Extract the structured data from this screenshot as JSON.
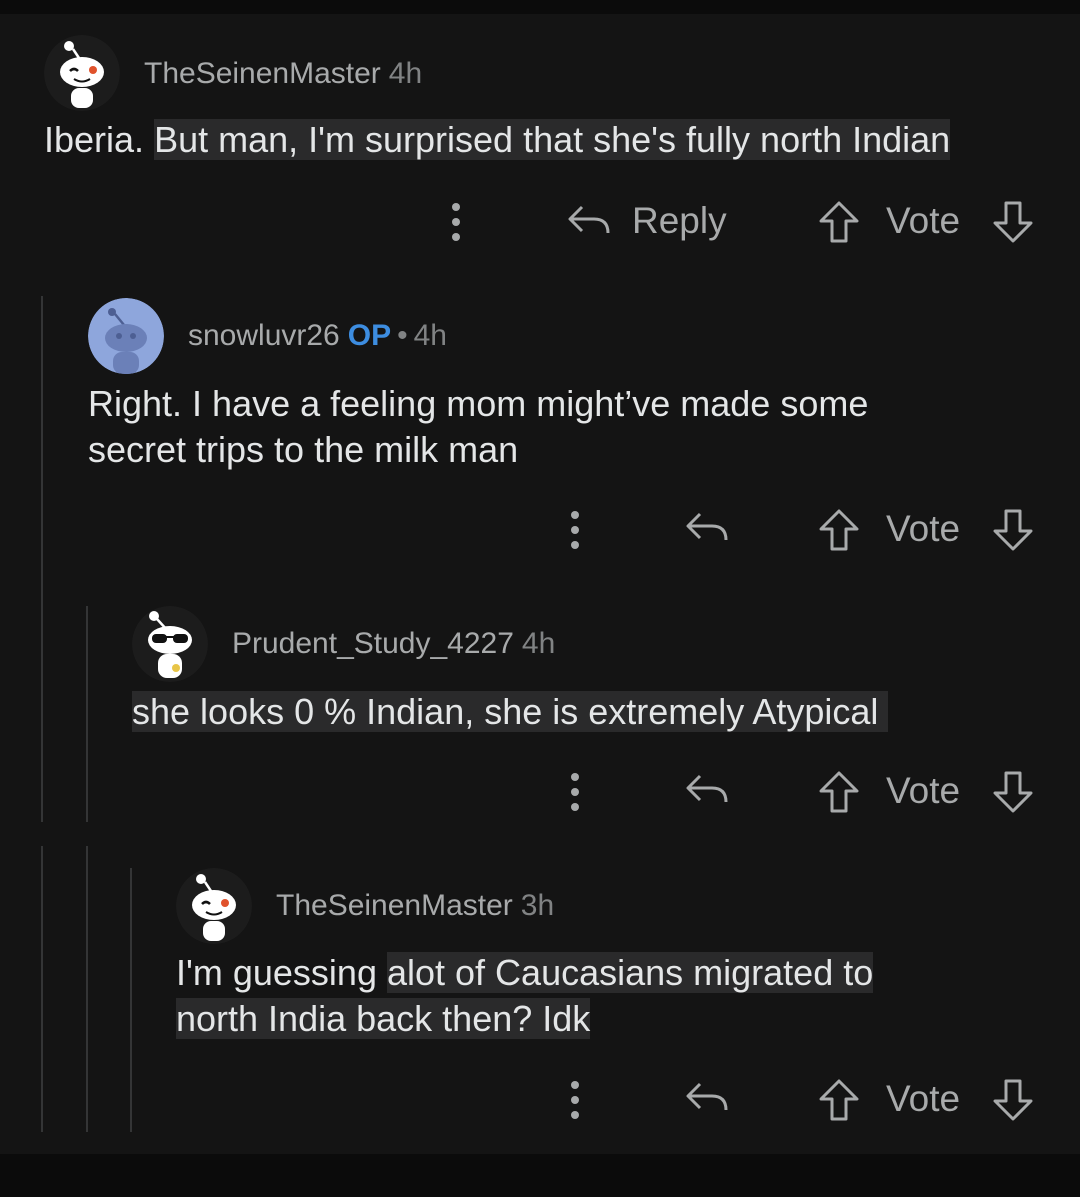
{
  "colors": {
    "background": "#141414",
    "text": "#e4e6e7",
    "muted": "#818384",
    "op_accent": "#3d8de0",
    "highlight": "#2a2a2b"
  },
  "comments": [
    {
      "username": "TheSeinenMaster",
      "time": "4h",
      "avatar": "snoo-winking-avatar",
      "body_plain": "Iberia. ",
      "body_highlight": "But man, I'm surprised that she's fully north Indian",
      "reply_label": "Reply",
      "vote_label": "Vote"
    },
    {
      "username": "snowluvr26",
      "op_label": "OP",
      "separator": "•",
      "time": "4h",
      "avatar": "snoo-blue-avatar",
      "body_line1": "Right. I have a feeling mom might’ve made some",
      "body_line2": "secret trips to the milk man",
      "vote_label": "Vote"
    },
    {
      "username": "Prudent_Study_4227",
      "time": "4h",
      "avatar": "snoo-sunglasses-avatar",
      "body_highlight": "she looks 0 % Indian, she is extremely Atypical",
      "vote_label": "Vote"
    },
    {
      "username": "TheSeinenMaster",
      "time": "3h",
      "avatar": "snoo-winking-avatar",
      "body_plain": "I'm guessing ",
      "body_highlight1": "alot of Caucasians migrated to",
      "body_highlight2": "north India back then? Idk",
      "vote_label": "Vote"
    }
  ]
}
